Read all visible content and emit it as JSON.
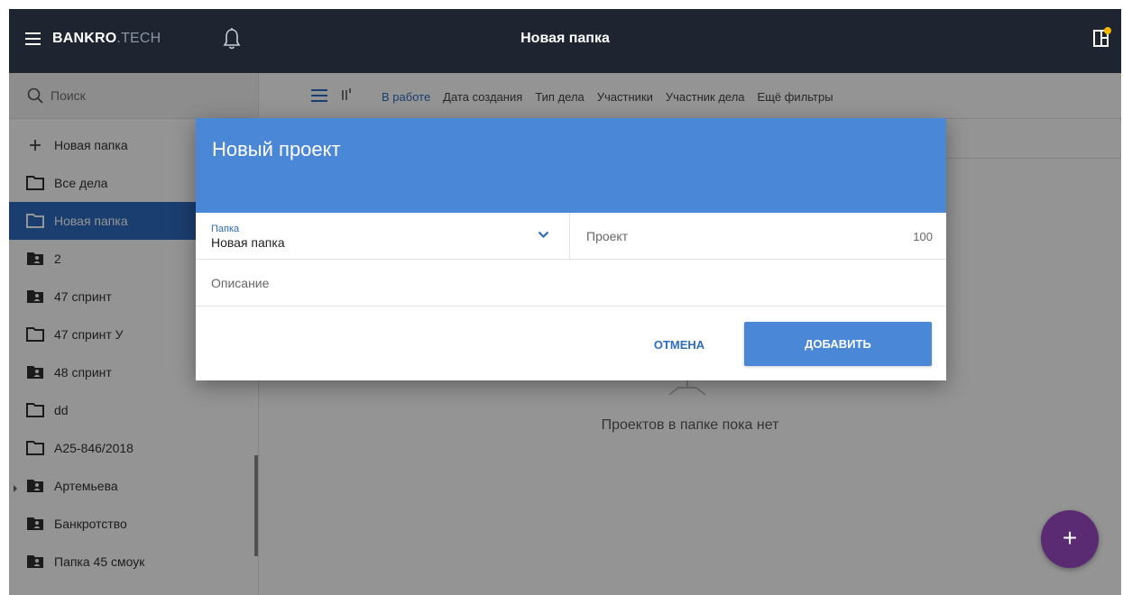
{
  "header": {
    "logo_bold": "BANKRO",
    "logo_suffix": ".TECH",
    "title": "Новая папка",
    "icons": {
      "menu": "menu-icon",
      "bell": "bell-icon",
      "corner": "panel-icon"
    },
    "badge_color": "#f5b800"
  },
  "sidebar": {
    "search_placeholder": "Поиск",
    "items": [
      {
        "label": "Новая папка",
        "icon": "plus-icon",
        "kind": "add"
      },
      {
        "label": "Все дела",
        "icon": "folder-outline-icon",
        "kind": "outline"
      },
      {
        "label": "Новая папка",
        "icon": "folder-outline-icon",
        "kind": "outline",
        "active": true
      },
      {
        "label": "2",
        "icon": "folder-shared-icon",
        "kind": "shared"
      },
      {
        "label": "47 спринт",
        "icon": "folder-shared-icon",
        "kind": "shared"
      },
      {
        "label": "47 спринт У",
        "icon": "folder-outline-icon",
        "kind": "outline"
      },
      {
        "label": "48 спринт",
        "icon": "folder-shared-icon",
        "kind": "shared"
      },
      {
        "label": "dd",
        "icon": "folder-outline-icon",
        "kind": "outline"
      },
      {
        "label": "А25-846/2018",
        "icon": "folder-outline-icon",
        "kind": "outline"
      },
      {
        "label": "Артемьева",
        "icon": "folder-shared-icon",
        "kind": "shared",
        "expandable": true
      },
      {
        "label": "Банкротство",
        "icon": "folder-shared-icon",
        "kind": "shared"
      },
      {
        "label": "Папка 45 смоук",
        "icon": "folder-shared-icon",
        "kind": "shared"
      }
    ]
  },
  "filterbar": {
    "filters": [
      "В работе",
      "Дата создания",
      "Тип дела",
      "Участники",
      "Участник дела",
      "Ещё фильтры"
    ],
    "active": "В работе"
  },
  "main": {
    "empty_text": "Проектов в папке пока нет"
  },
  "dialog": {
    "title": "Новый проект",
    "folder_label": "Папка",
    "folder_value": "Новая папка",
    "project_placeholder": "Проект",
    "project_counter": "100",
    "description_placeholder": "Описание",
    "cancel_label": "ОТМЕНА",
    "add_label": "ДОБАВИТЬ"
  },
  "fab_label": "+",
  "colors": {
    "topbar": "#1e2530",
    "accent": "#2d6cc0",
    "dialog_header": "#4a87d6",
    "fab": "#5a2a72"
  }
}
